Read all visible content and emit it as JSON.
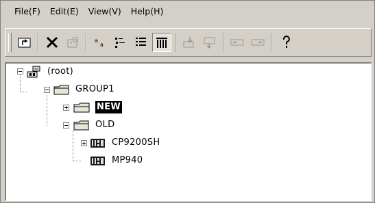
{
  "menu": {
    "items": [
      "File(F)",
      "Edit(E)",
      "View(V)",
      "Help(H)"
    ]
  },
  "toolbar": {
    "buttons": [
      {
        "icon": "up-folder-icon",
        "pressed": false
      },
      {
        "icon": "delete-icon",
        "pressed": false
      },
      {
        "icon": "properties-icon",
        "pressed": false
      },
      {
        "icon": "large-icons-view-icon",
        "pressed": false
      },
      {
        "icon": "small-icons-view-icon",
        "pressed": false
      },
      {
        "icon": "list-view-icon",
        "pressed": false
      },
      {
        "icon": "details-view-icon",
        "pressed": true
      },
      {
        "icon": "transfer-in-icon",
        "pressed": false
      },
      {
        "icon": "transfer-out-icon",
        "pressed": false
      },
      {
        "icon": "device-a-icon",
        "pressed": false
      },
      {
        "icon": "device-b-icon",
        "pressed": false
      },
      {
        "icon": "help-icon",
        "pressed": false
      }
    ]
  },
  "tree": {
    "root": {
      "label": "(root)",
      "expanded": true
    },
    "group1": {
      "label": "GROUP1",
      "expanded": true
    },
    "new": {
      "label": "NEW",
      "expanded": false,
      "selected": true
    },
    "old": {
      "label": "OLD",
      "expanded": true
    },
    "cp": {
      "label": "CP9200SH",
      "expanded": false
    },
    "mp": {
      "label": "MP940"
    }
  },
  "colors": {
    "face": "#d4d0c8",
    "selection": "#000000",
    "folder": "#e8e4d8"
  }
}
